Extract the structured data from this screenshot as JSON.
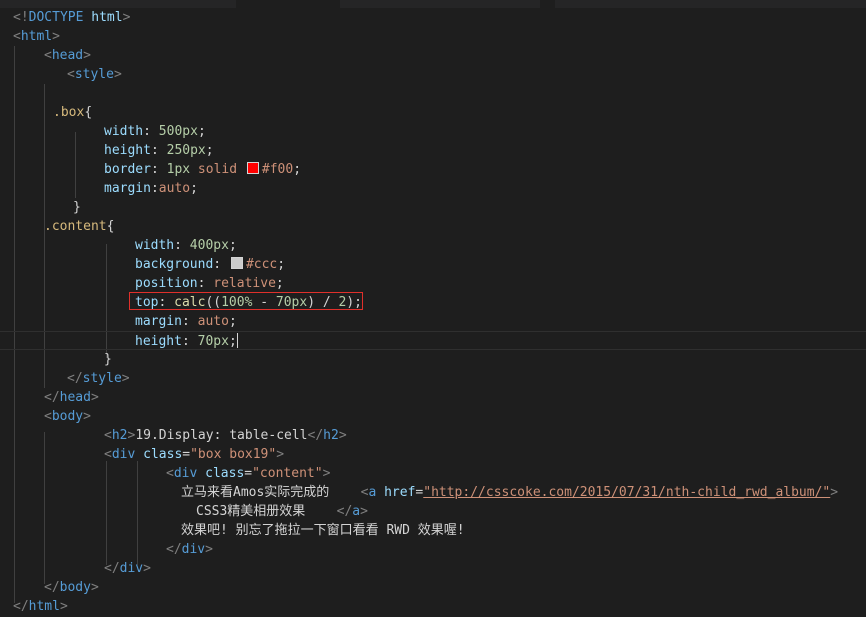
{
  "editor": {
    "colors": {
      "background": "#1e1e1e",
      "tag": "#569cd6",
      "attribute": "#9cdcfe",
      "string": "#ce9178",
      "selector": "#d7ba7d",
      "number": "#b5cea8",
      "highlight_box": "#e0302b"
    },
    "swatches": {
      "red": "#f00",
      "gray": "#ccc"
    },
    "l1": {
      "a": "<!",
      "b": "DOCTYPE",
      "c": " html",
      "d": ">"
    },
    "l2": {
      "a": "<",
      "b": "html",
      "c": ">"
    },
    "l3": {
      "a": "<",
      "b": "head",
      "c": ">"
    },
    "l4": {
      "a": "<",
      "b": "style",
      "c": ">"
    },
    "l6": {
      "a": ".box",
      "b": "{"
    },
    "l7": {
      "p": "width",
      "c": ": ",
      "v": "500px",
      "s": ";"
    },
    "l8": {
      "p": "height",
      "c": ": ",
      "v": "250px",
      "s": ";"
    },
    "l9": {
      "p": "border",
      "c": ": ",
      "v1": "1px",
      "v2": " solid ",
      "v3": "#f00",
      "s": ";"
    },
    "l10": {
      "p": "margin",
      "c": ":",
      "v": "auto",
      "s": ";"
    },
    "l11": {
      "a": "}"
    },
    "l12": {
      "a": ".content",
      "b": "{"
    },
    "l13": {
      "p": "width",
      "c": ": ",
      "v": "400px",
      "s": ";"
    },
    "l14": {
      "p": "background",
      "c": ": ",
      "v": "#ccc",
      "s": ";"
    },
    "l15": {
      "p": "position",
      "c": ": ",
      "v": "relative",
      "s": ";"
    },
    "l16": {
      "p": "top",
      "c": ": ",
      "f": "calc",
      "o": "((",
      "n1": "100%",
      "m": " - ",
      "n2": "70px",
      "cl": ") / ",
      "n3": "2",
      "e": ");"
    },
    "l17": {
      "p": "margin",
      "c": ": ",
      "v": "auto",
      "s": ";"
    },
    "l18": {
      "p": "height",
      "c": ": ",
      "v": "70px",
      "s": ";"
    },
    "l19": {
      "a": "}"
    },
    "l20": {
      "a": "</",
      "b": "style",
      "c": ">"
    },
    "l21": {
      "a": "</",
      "b": "head",
      "c": ">"
    },
    "l22": {
      "a": "<",
      "b": "body",
      "c": ">"
    },
    "l23": {
      "a": "<",
      "b": "h2",
      "c": ">",
      "t": "19.Display: table-cell",
      "d": "</",
      "e": "h2",
      "f": ">"
    },
    "l24": {
      "a": "<",
      "b": "div",
      "s": " ",
      "at": "class",
      "eq": "=",
      "v": "\"box box19\"",
      "c": ">"
    },
    "l25": {
      "a": "<",
      "b": "div",
      "s": " ",
      "at": "class",
      "eq": "=",
      "v": "\"content\"",
      "c": ">"
    },
    "l26": {
      "t": "立马来看Amos实际完成的",
      "gap": "    ",
      "a": "<",
      "b": "a",
      "s": " ",
      "at": "href",
      "eq": "=",
      "v": "\"http://csscoke.com/2015/07/31/nth-child_rwd_album/\"",
      "c": ">"
    },
    "l27": {
      "t": "CSS3精美相册效果",
      "gap": "    ",
      "a": "</",
      "b": "a",
      "c": ">"
    },
    "l28": {
      "t": "效果吧! 别忘了拖拉一下窗口看看 RWD 效果喔!"
    },
    "l29": {
      "a": "</",
      "b": "div",
      "c": ">"
    },
    "l30": {
      "a": "</",
      "b": "div",
      "c": ">"
    },
    "l31": {
      "a": "</",
      "b": "body",
      "c": ">"
    },
    "l32": {
      "a": "</",
      "b": "html",
      "c": ">"
    }
  }
}
